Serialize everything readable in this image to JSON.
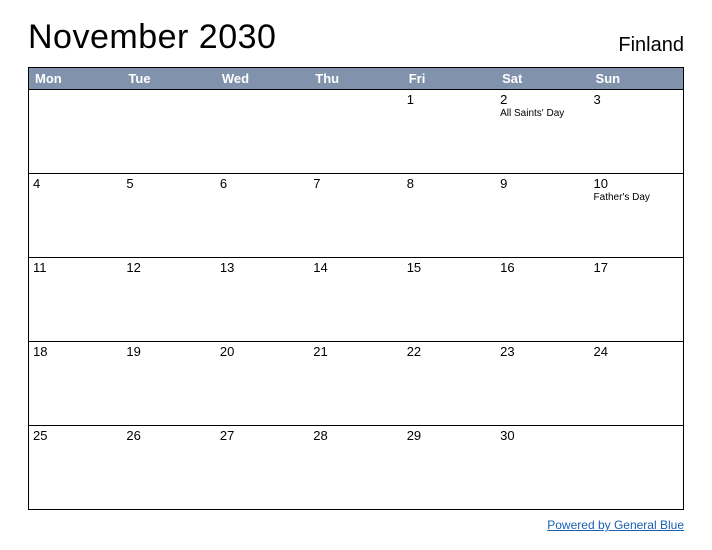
{
  "title": "November 2030",
  "country": "Finland",
  "day_headers": [
    "Mon",
    "Tue",
    "Wed",
    "Thu",
    "Fri",
    "Sat",
    "Sun"
  ],
  "weeks": [
    [
      {
        "day": "",
        "event": ""
      },
      {
        "day": "",
        "event": ""
      },
      {
        "day": "",
        "event": ""
      },
      {
        "day": "",
        "event": ""
      },
      {
        "day": "1",
        "event": ""
      },
      {
        "day": "2",
        "event": "All Saints' Day"
      },
      {
        "day": "3",
        "event": ""
      }
    ],
    [
      {
        "day": "4",
        "event": ""
      },
      {
        "day": "5",
        "event": ""
      },
      {
        "day": "6",
        "event": ""
      },
      {
        "day": "7",
        "event": ""
      },
      {
        "day": "8",
        "event": ""
      },
      {
        "day": "9",
        "event": ""
      },
      {
        "day": "10",
        "event": "Father's Day"
      }
    ],
    [
      {
        "day": "11",
        "event": ""
      },
      {
        "day": "12",
        "event": ""
      },
      {
        "day": "13",
        "event": ""
      },
      {
        "day": "14",
        "event": ""
      },
      {
        "day": "15",
        "event": ""
      },
      {
        "day": "16",
        "event": ""
      },
      {
        "day": "17",
        "event": ""
      }
    ],
    [
      {
        "day": "18",
        "event": ""
      },
      {
        "day": "19",
        "event": ""
      },
      {
        "day": "20",
        "event": ""
      },
      {
        "day": "21",
        "event": ""
      },
      {
        "day": "22",
        "event": ""
      },
      {
        "day": "23",
        "event": ""
      },
      {
        "day": "24",
        "event": ""
      }
    ],
    [
      {
        "day": "25",
        "event": ""
      },
      {
        "day": "26",
        "event": ""
      },
      {
        "day": "27",
        "event": ""
      },
      {
        "day": "28",
        "event": ""
      },
      {
        "day": "29",
        "event": ""
      },
      {
        "day": "30",
        "event": ""
      },
      {
        "day": "",
        "event": ""
      }
    ]
  ],
  "footer_link": "Powered by General Blue"
}
